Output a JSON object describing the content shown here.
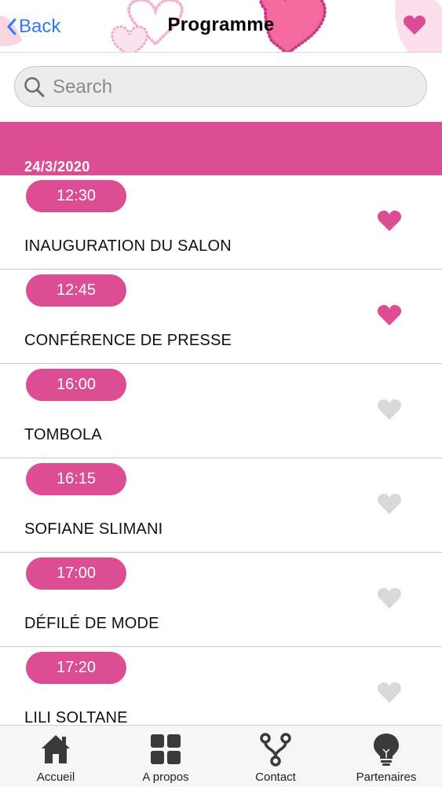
{
  "header": {
    "back_label": "Back",
    "title": "Programme"
  },
  "search": {
    "placeholder": "Search",
    "value": ""
  },
  "date": "24/3/2020",
  "events": [
    {
      "time": "12:30",
      "name": "INAUGURATION DU SALON",
      "favorite": true
    },
    {
      "time": "12:45",
      "name": "CONFÉRENCE DE PRESSE",
      "favorite": true
    },
    {
      "time": "16:00",
      "name": "TOMBOLA",
      "favorite": false
    },
    {
      "time": "16:15",
      "name": "SOFIANE SLIMANI",
      "favorite": false
    },
    {
      "time": "17:00",
      "name": "DÉFILÉ DE MODE",
      "favorite": false
    },
    {
      "time": "17:20",
      "name": "LILI SOLTANE",
      "favorite": false
    }
  ],
  "tabs": [
    {
      "label": "Accueil",
      "icon": "home-icon"
    },
    {
      "label": "A propos",
      "icon": "grid-icon"
    },
    {
      "label": "Contact",
      "icon": "fork-icon"
    },
    {
      "label": "Partenaires",
      "icon": "lightbulb-icon"
    }
  ],
  "colors": {
    "accent": "#dc4d93",
    "link": "#2f7cf6",
    "heart_off": "#d9d9d9"
  }
}
